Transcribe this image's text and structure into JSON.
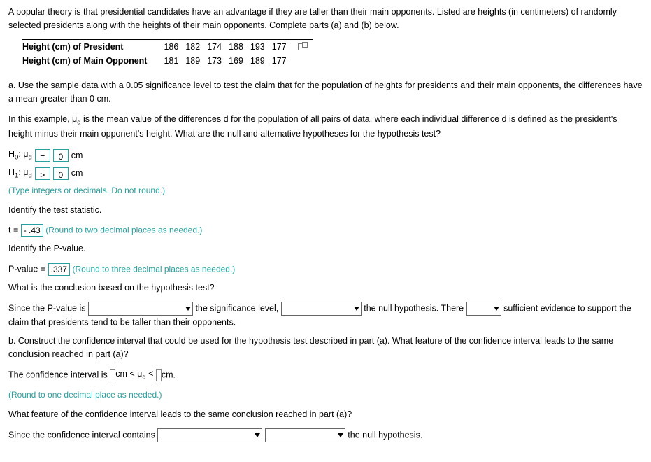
{
  "intro": "A popular theory is that presidential candidates have an advantage if they are taller than their main opponents. Listed are heights (in centimeters) of randomly selected presidents along with the heights of their main opponents. Complete parts (a) and (b) below.",
  "table": {
    "rowHead1": "Height (cm) of President",
    "rowHead2": "Height (cm) of Main Opponent",
    "presidents": [
      "186",
      "182",
      "174",
      "188",
      "193",
      "177"
    ],
    "opponents": [
      "181",
      "189",
      "173",
      "169",
      "189",
      "177"
    ]
  },
  "partA": {
    "prompt": "a. Use the sample data with a 0.05 significance level to test the claim that for the population of heights for presidents and their main opponents, the differences have a mean greater than 0 cm.",
    "context1": "In this example, ",
    "muD": "μ",
    "dSub": "d",
    "context2": " is the mean value of the differences d for the population of all pairs of data, where each individual difference d is defined as the president's height minus their main opponent's height. What are the null and alternative hypotheses for the hypothesis test?",
    "h0Label": "H",
    "h0Sub": "0",
    "h0Mu": ": μ",
    "h0Op": "=",
    "h0Val": "0",
    "h1Sub": "1",
    "h1Op": ">",
    "h1Val": "0",
    "unitCm": "cm",
    "hypNote": "(Type integers or decimals. Do not round.)",
    "idTestStat": "Identify the test statistic.",
    "tEq": "t = ",
    "tVal": "- .43",
    "tNote": "(Round to two decimal places as needed.)",
    "idPval": "Identify the P-value.",
    "pEq": "P-value = ",
    "pVal": ".337",
    "pNote": "(Round to three decimal places as needed.)",
    "conclQ": "What is the conclusion based on the hypothesis test?",
    "concl1": "Since the P-value is ",
    "concl2": " the significance level, ",
    "concl3": " the null hypothesis. There ",
    "concl4": " sufficient evidence to support the claim that presidents tend to be taller than their opponents."
  },
  "partB": {
    "prompt": "b. Construct the confidence interval that could be used for the hypothesis test described in part (a). What feature of the confidence interval leads to the same conclusion reached in part (a)?",
    "ci1": "The confidence interval is ",
    "ciMid": " cm < μ",
    "ciLt": " < ",
    "ciEnd": " cm.",
    "ciNote": "(Round to one decimal place as needed.)",
    "featQ": "What feature of the confidence interval leads to the same conclusion reached in part (a)?",
    "feat1": "Since the confidence interval contains ",
    "feat2": " the null hypothesis."
  }
}
